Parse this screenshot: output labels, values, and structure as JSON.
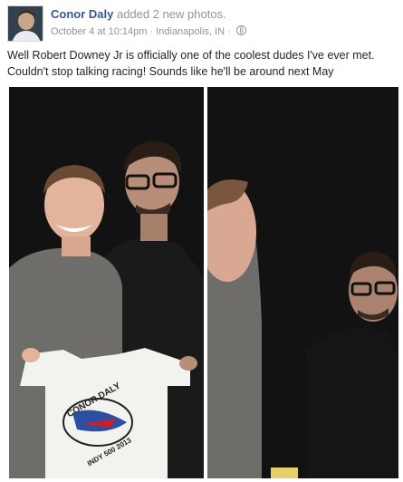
{
  "post": {
    "author": "Conor Daly",
    "action": "added 2 new photos.",
    "date": "October 4 at 10:14pm",
    "location": "Indianapolis, IN",
    "separator": "·",
    "caption_line1": "Well Robert Downey Jr is officially one of the coolest dudes I've ever met.",
    "caption_line2": "Couldn't stop talking racing! Sounds like he'll be around next May"
  },
  "photos": {
    "left": {
      "shirt_text_top": "CONOR DALY",
      "shirt_text_bottom": "INDY 500 2013"
    }
  },
  "icons": {
    "privacy": "globe-icon"
  },
  "colors": {
    "author_link": "#365899",
    "meta_text": "#90949c",
    "body_text": "#1d2129",
    "photo_background": "#121212"
  }
}
